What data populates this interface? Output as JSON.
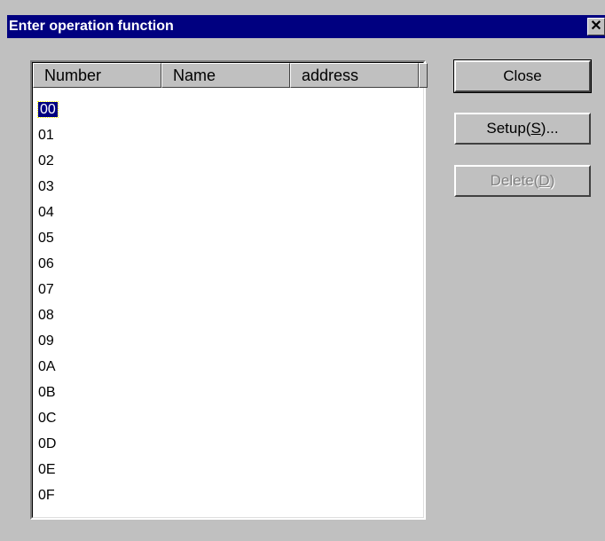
{
  "window": {
    "title": "Enter operation function",
    "close_glyph": "✕"
  },
  "list": {
    "columns": [
      "Number",
      "Name",
      "address"
    ],
    "rows": [
      "00",
      "01",
      "02",
      "03",
      "04",
      "05",
      "06",
      "07",
      "08",
      "09",
      "0A",
      "0B",
      "0C",
      "0D",
      "0E",
      "0F"
    ],
    "selected_index": 0
  },
  "buttons": {
    "close": "Close",
    "setup": "Setup(S)...",
    "delete": "Delete(D)"
  },
  "colors": {
    "titlebar": "#000080",
    "face": "#c0c0c0",
    "selection": "#000080"
  }
}
